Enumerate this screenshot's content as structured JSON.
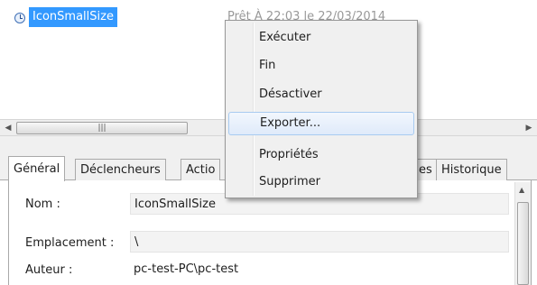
{
  "task_list": {
    "name": "IconSmallSize",
    "status": "Prêt      À 22:03 le 22/03/2014"
  },
  "context_menu": {
    "items": [
      "Exécuter",
      "Fin",
      "Désactiver",
      "Exporter...",
      "Propriétés",
      "Supprimer"
    ],
    "highlighted": "Exporter..."
  },
  "tabs": [
    "Général",
    "Déclencheurs",
    "Actio",
    "es",
    "Historique"
  ],
  "active_tab": "Général",
  "general": {
    "name_label": "Nom :",
    "name_value": "IconSmallSize",
    "location_label": "Emplacement :",
    "location_value": "\\",
    "author_label": "Auteur :",
    "author_value": "pc-test-PC\\pc-test"
  },
  "colors": {
    "selection": "#3399ff",
    "menu_background": "#f0f0f0",
    "menu_hover": "#dfeafa"
  },
  "icons": {
    "task": "clock-icon",
    "scroll_left": "chevron-left-icon",
    "scroll_right": "chevron-right-icon",
    "scroll_up": "chevron-up-icon"
  }
}
